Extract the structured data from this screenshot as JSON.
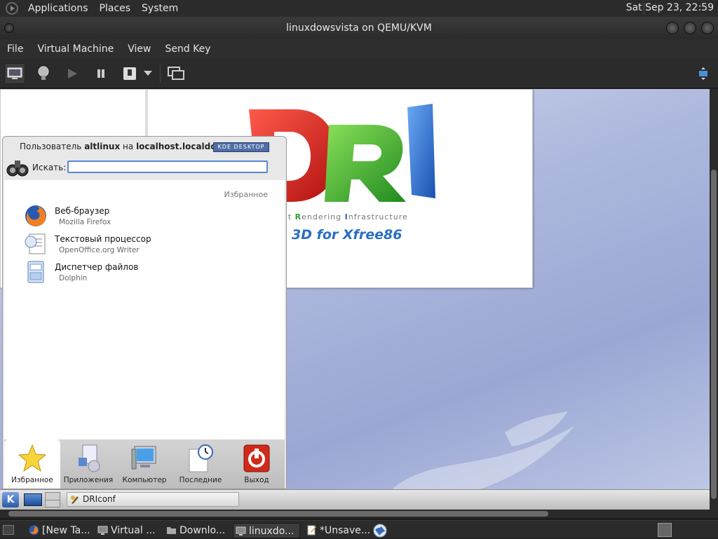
{
  "top_panel": {
    "menus": [
      "Applications",
      "Places",
      "System"
    ],
    "clock": "Sat Sep 23, 22:59"
  },
  "window": {
    "title": "linuxdowsvista on QEMU/KVM",
    "menubar": [
      "File",
      "Virtual Machine",
      "View",
      "Send Key"
    ]
  },
  "toolbar": {
    "buttons": [
      "console-icon",
      "lightbulb-icon",
      "run-icon",
      "pause-icon",
      "shutdown-icon",
      "dropdown-arrow-icon",
      "screenshot-icon",
      "fullscreen-icon"
    ]
  },
  "guest": {
    "dri": {
      "subtitle_parts": [
        "ect ",
        "R",
        "endering ",
        "I",
        "nfrastructure"
      ],
      "tagline": "3D for Xfree86"
    },
    "kickoff": {
      "user_prefix": "Пользователь",
      "user": "altlinux",
      "user_mid": "на",
      "host": "localhost.localdomain",
      "badge": "KDE DESKTOP",
      "search_label": "Искать:",
      "search_value": "",
      "section_title": "Избранное",
      "favorites": [
        {
          "name": "Веб-браузер",
          "desc": "Mozilla Firefox",
          "icon": "firefox-icon"
        },
        {
          "name": "Текстовый процессор",
          "desc": "OpenOffice.org Writer",
          "icon": "writer-icon"
        },
        {
          "name": "Диспетчер файлов",
          "desc": "Dolphin",
          "icon": "file-manager-icon"
        }
      ],
      "tabs": [
        {
          "label": "Избранное",
          "icon": "star-icon",
          "active": true
        },
        {
          "label": "Приложения",
          "icon": "applications-icon",
          "active": false
        },
        {
          "label": "Компьютер",
          "icon": "computer-icon",
          "active": false
        },
        {
          "label": "Последние",
          "icon": "recent-icon",
          "active": false
        },
        {
          "label": "Выход",
          "icon": "logout-icon",
          "active": false
        }
      ]
    },
    "kde_panel": {
      "task": "DRIconf"
    }
  },
  "bottom_panel": {
    "tasks": [
      {
        "label": "[New Ta...",
        "icon": "firefox-icon",
        "active": false
      },
      {
        "label": "Virtual ...",
        "icon": "virt-manager-icon",
        "active": false
      },
      {
        "label": "Downlo...",
        "icon": "folder-icon",
        "active": false
      },
      {
        "label": "linuxdo...",
        "icon": "vm-console-icon",
        "active": true
      },
      {
        "label": "*Unsave...",
        "icon": "text-editor-icon",
        "active": false
      }
    ]
  }
}
